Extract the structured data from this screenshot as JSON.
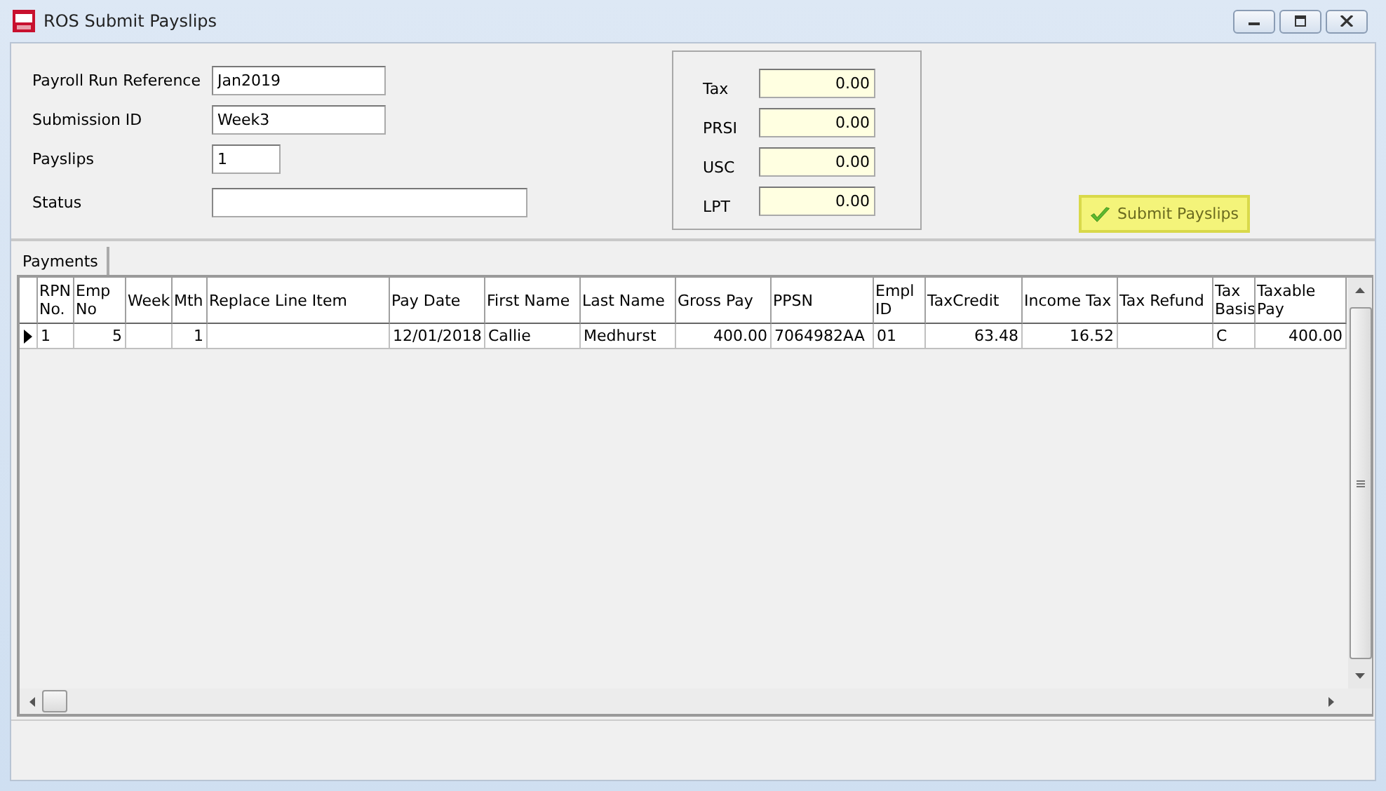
{
  "window": {
    "title": "ROS Submit Payslips"
  },
  "form": {
    "fields": [
      {
        "label": "Payroll Run Reference",
        "value": "Jan2019"
      },
      {
        "label": "Submission ID",
        "value": "Week3"
      },
      {
        "label": "Payslips",
        "value": "1"
      },
      {
        "label": "Status"
      }
    ]
  },
  "totals": [
    {
      "label": "Tax",
      "value": "0.00"
    },
    {
      "label": "PRSI",
      "value": "0.00"
    },
    {
      "label": "USC",
      "value": "0.00"
    },
    {
      "label": "LPT",
      "value": "0.00"
    }
  ],
  "submit_button": {
    "label": "Submit Payslips"
  },
  "tabs": [
    {
      "label": "Payments",
      "selected": true
    }
  ],
  "table": {
    "columns": [
      {
        "label": "RPN No.",
        "kind": "text"
      },
      {
        "label": "Emp No",
        "kind": "number"
      },
      {
        "label": "Week",
        "kind": "number"
      },
      {
        "label": "Mth",
        "kind": "number"
      },
      {
        "label": "Replace Line Item",
        "kind": "text"
      },
      {
        "label": "Pay Date",
        "kind": "text"
      },
      {
        "label": "First Name",
        "kind": "text"
      },
      {
        "label": "Last Name",
        "kind": "text"
      },
      {
        "label": "Gross Pay",
        "kind": "number"
      },
      {
        "label": "PPSN",
        "kind": "text"
      },
      {
        "label": "Empl ID",
        "kind": "text"
      },
      {
        "label": "TaxCredit",
        "kind": "number"
      },
      {
        "label": "Income Tax",
        "kind": "number"
      },
      {
        "label": "Tax Refund",
        "kind": "number"
      },
      {
        "label": "Tax Basis",
        "kind": "text"
      },
      {
        "label": "Taxable Pay",
        "kind": "number"
      }
    ],
    "rows": [
      {
        "selected": true,
        "cells": [
          "1",
          "5",
          "",
          "1",
          "",
          "12/01/2018",
          "Callie",
          "Medhurst",
          "400.00",
          "7064982AA",
          "01",
          "63.48",
          "16.52",
          "",
          "C",
          "400.00"
        ]
      }
    ]
  }
}
